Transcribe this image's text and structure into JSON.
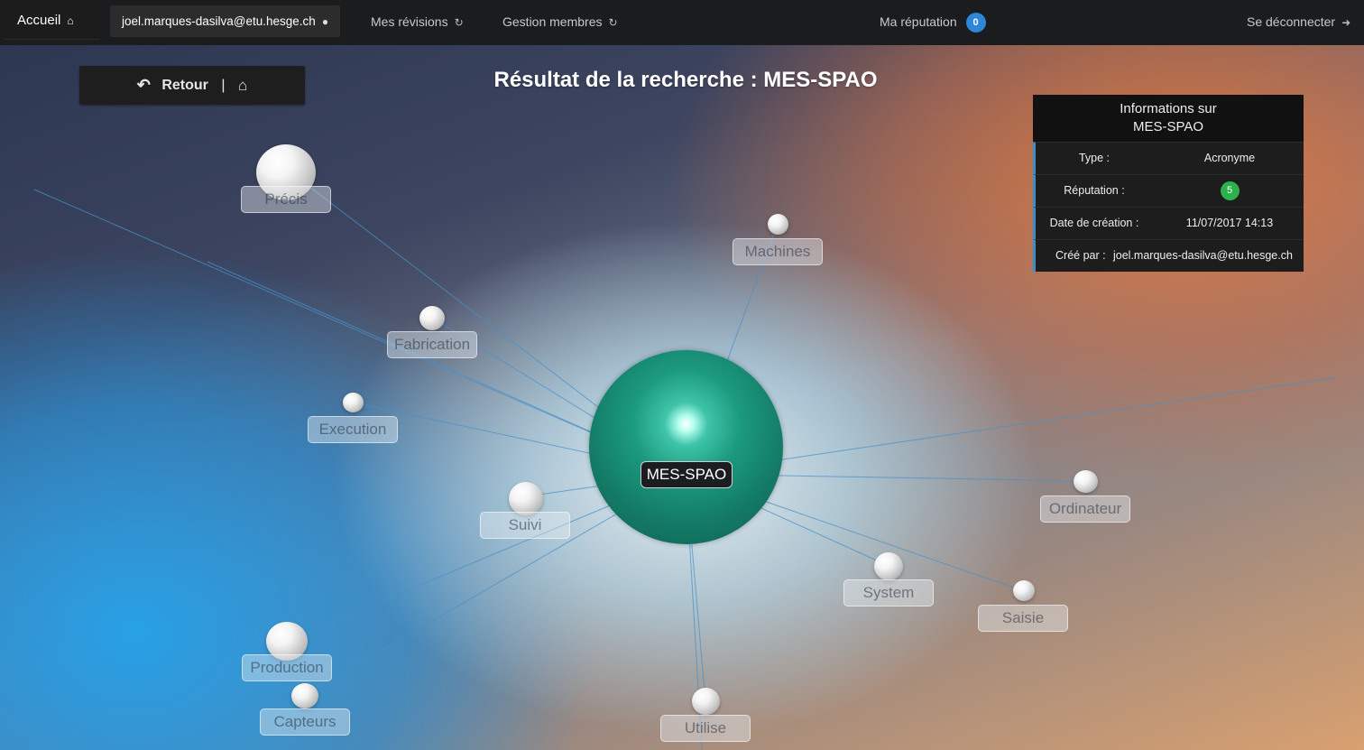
{
  "nav": {
    "home_label": "Accueil",
    "home_icon": "home-icon",
    "user_email": "joel.marques-dasilva@etu.hesge.ch",
    "user_icon": "user-icon",
    "revisions_label": "Mes révisions",
    "members_label": "Gestion membres",
    "history_icon": "history-icon",
    "reputation_label": "Ma réputation",
    "reputation_count": "0",
    "logout_label": "Se déconnecter",
    "logout_icon": "sign-out-icon"
  },
  "back_button": {
    "label": "Retour",
    "separator": "|"
  },
  "page_title": "Résultat de la recherche : MES-SPAO",
  "info_panel": {
    "title_line1": "Informations sur",
    "title_line2": "MES-SPAO",
    "type_key": "Type :",
    "type_value": "Acronyme",
    "reputation_key": "Réputation :",
    "reputation_value": "5",
    "date_key": "Date de création :",
    "date_value": "11/07/2017 14:13",
    "creator_key": "Créé par :",
    "creator_value": "joel.marques-dasilva@etu.hesge.ch"
  },
  "graph": {
    "center_label": "MES-SPAO",
    "center_color": "#1c9a80",
    "nodes": [
      {
        "label": "Précis"
      },
      {
        "label": "Machines"
      },
      {
        "label": "Fabrication"
      },
      {
        "label": "Execution"
      },
      {
        "label": "Suivi"
      },
      {
        "label": "Ordinateur"
      },
      {
        "label": "System"
      },
      {
        "label": "Saisie"
      },
      {
        "label": "Production"
      },
      {
        "label": "Capteurs"
      },
      {
        "label": "Utilise"
      }
    ]
  },
  "colors": {
    "navbar": "#1a1c1e",
    "link_line": "#4a90c8",
    "badge_blue": "#2d86d8",
    "badge_green": "#2bb24c",
    "panel_accent": "#3b8fc9"
  }
}
